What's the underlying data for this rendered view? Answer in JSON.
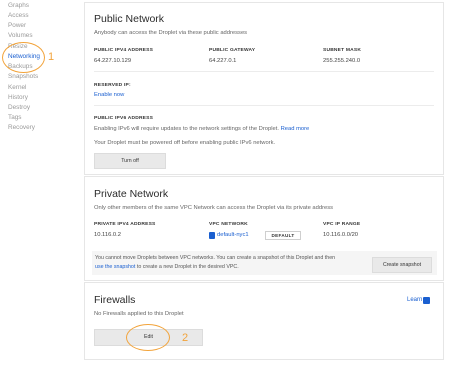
{
  "sidebar": {
    "items": [
      {
        "label": "Graphs"
      },
      {
        "label": "Access"
      },
      {
        "label": "Power"
      },
      {
        "label": "Volumes"
      },
      {
        "label": "Resize"
      },
      {
        "label": "Networking"
      },
      {
        "label": "Backups"
      },
      {
        "label": "Snapshots"
      },
      {
        "label": "Kernel"
      },
      {
        "label": "History"
      },
      {
        "label": "Destroy"
      },
      {
        "label": "Tags"
      },
      {
        "label": "Recovery"
      }
    ],
    "active_index": 5
  },
  "annotations": {
    "one": "1",
    "two": "2"
  },
  "public_network": {
    "title": "Public Network",
    "subtitle": "Anybody can access the Droplet via these public addresses",
    "ipv4_label": "PUBLIC IPV4 ADDRESS",
    "ipv4_value": "64.227.10.129",
    "gateway_label": "PUBLIC GATEWAY",
    "gateway_value": "64.227.0.1",
    "mask_label": "SUBNET MASK",
    "mask_value": "255.255.240.0",
    "reserved_label": "RESERVED IP:",
    "reserved_link": "Enable now",
    "ipv6_label": "PUBLIC IPV6 ADDRESS",
    "ipv6_text": "Enabling IPv6 will require updates to the network settings of the Droplet.",
    "ipv6_link": "Read more",
    "power_text": "Your Droplet must be powered off before enabling public IPv6 network.",
    "turn_off": "Turn off"
  },
  "private_network": {
    "title": "Private Network",
    "subtitle": "Only other members of the same VPC Network can access the Droplet via its private address",
    "ipv4_label": "PRIVATE IPV4 ADDRESS",
    "ipv4_value": "10.116.0.2",
    "vpc_label": "VPC NETWORK",
    "vpc_value": "default-nyc1",
    "vpc_badge": "DEFAULT",
    "range_label": "VPC IP RANGE",
    "range_value": "10.116.0.0/20",
    "notice_text_1": "You cannot move Droplets between VPC networks. You can create a snapshot of this Droplet and then",
    "notice_link": "use the snapshot",
    "notice_text_2": "to create a new Droplet in the desired VPC.",
    "create_snapshot": "Create snapshot"
  },
  "firewalls": {
    "title": "Firewalls",
    "subtitle": "No Firewalls applied to this Droplet",
    "learn": "Learn",
    "edit": "Edit"
  }
}
